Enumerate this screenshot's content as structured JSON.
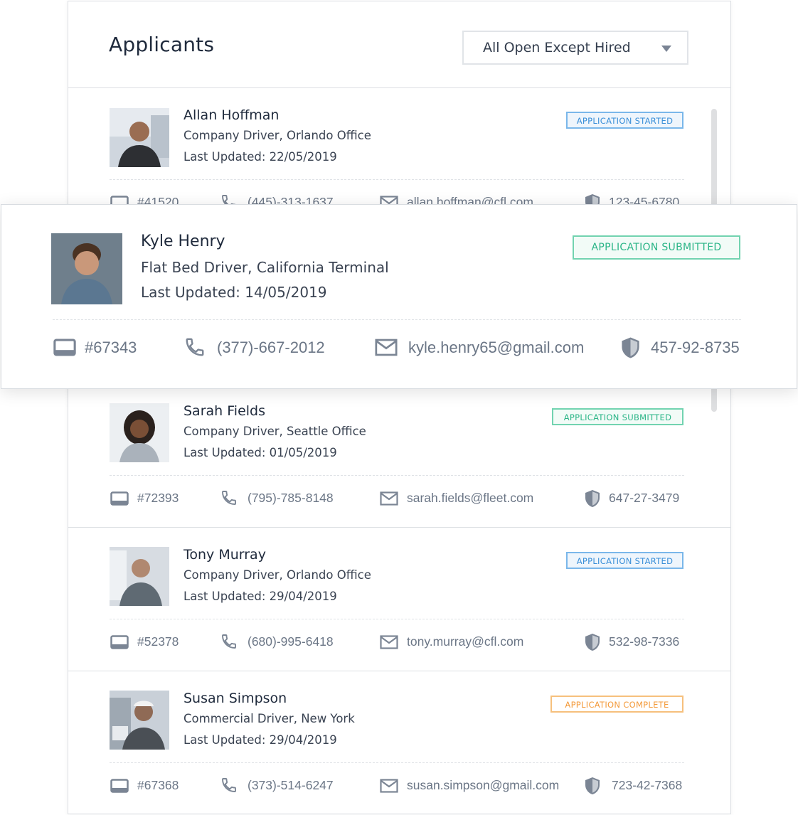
{
  "header": {
    "title": "Applicants",
    "filter_value": "All Open Except Hired"
  },
  "applicants": [
    {
      "name": "Allan Hoffman",
      "role": "Company Driver, Orlando Office",
      "updated": "Last Updated: 22/05/2019",
      "status": "APPLICATION STARTED",
      "id": "#41520",
      "phone": "(445)-313-1637",
      "email": "allan.hoffman@cfl.com",
      "ssn": "123-45-6780"
    },
    {
      "name": "Kyle Henry",
      "role": "Flat Bed Driver, California Terminal",
      "updated": "Last Updated: 14/05/2019",
      "status": "APPLICATION SUBMITTED",
      "id": "#67343",
      "phone": "(377)-667-2012",
      "email": "kyle.henry65@gmail.com",
      "ssn": "457-92-8735"
    },
    {
      "name": "Sarah Fields",
      "role": "Company Driver, Seattle Office",
      "updated": "Last Updated: 01/05/2019",
      "status": "APPLICATION SUBMITTED",
      "id": "#72393",
      "phone": "(795)-785-8148",
      "email": "sarah.fields@fleet.com",
      "ssn": "647-27-3479"
    },
    {
      "name": "Tony Murray",
      "role": "Company Driver, Orlando Office",
      "updated": "Last Updated: 29/04/2019",
      "status": "APPLICATION STARTED",
      "id": "#52378",
      "phone": "(680)-995-6418",
      "email": "tony.murray@cfl.com",
      "ssn": "532-98-7336"
    },
    {
      "name": "Susan Simpson",
      "role": "Commercial Driver, New York",
      "updated": "Last Updated: 29/04/2019",
      "status": "APPLICATION COMPLETE",
      "id": "#67368",
      "phone": "(373)-514-6247",
      "email": "susan.simpson@gmail.com",
      "ssn": "723-42-7368"
    }
  ],
  "colors": {
    "started": "#3a8fd8",
    "submitted": "#2bb587",
    "complete": "#f39a3a",
    "icon": "#7b8594"
  },
  "icons": [
    "id-card-icon",
    "phone-icon",
    "mail-icon",
    "shield-icon",
    "chevron-down-icon"
  ]
}
